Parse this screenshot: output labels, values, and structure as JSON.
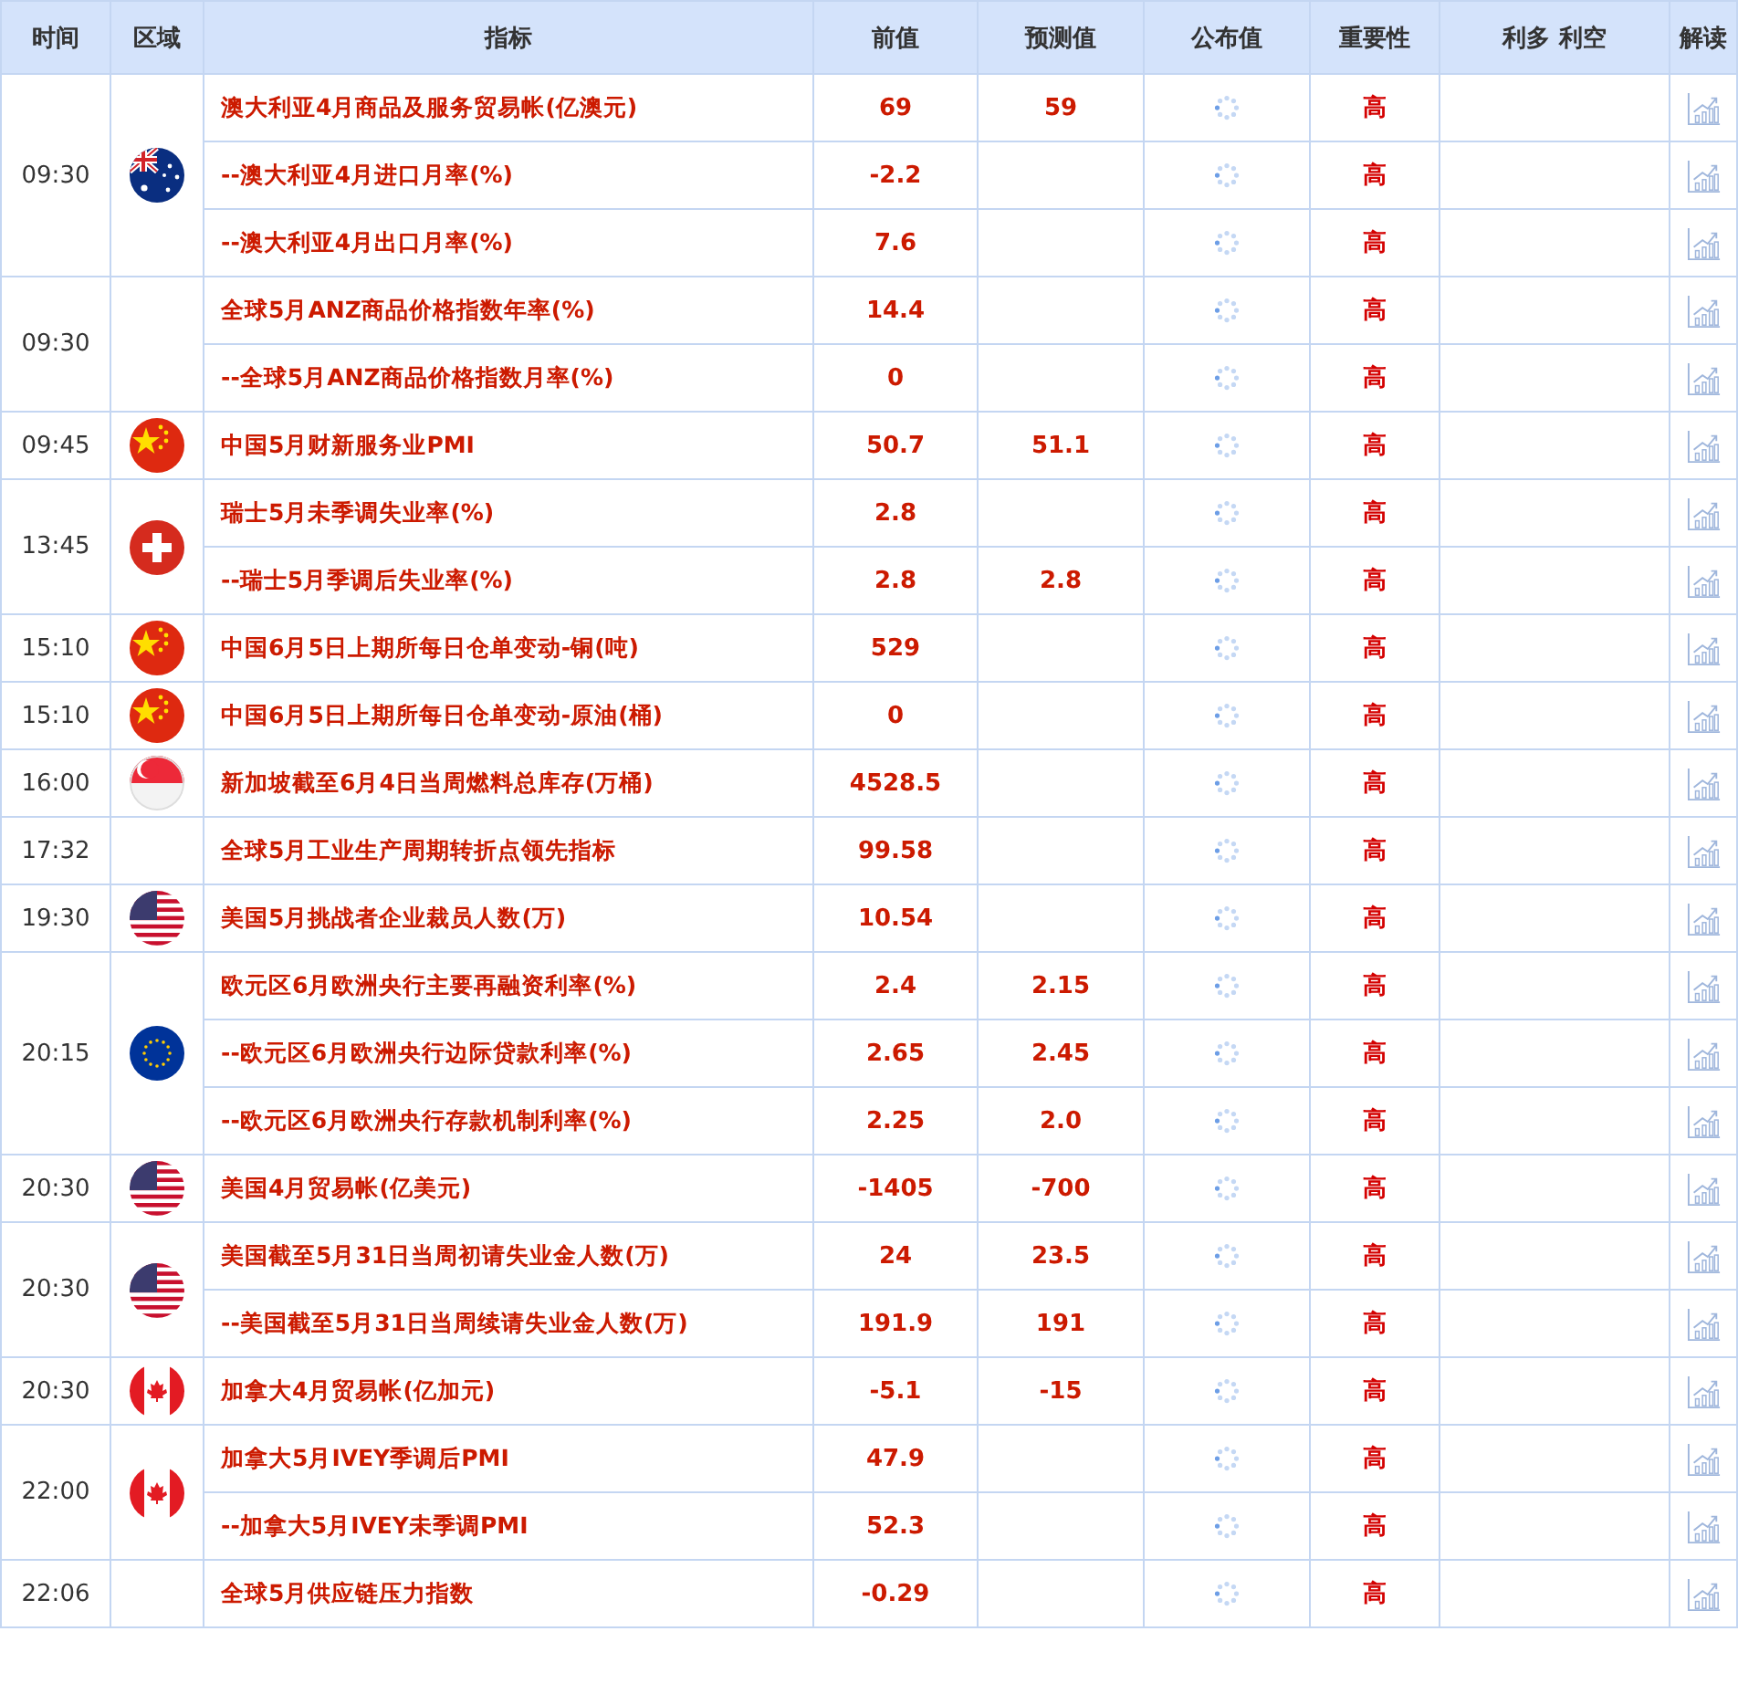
{
  "columns": [
    "时间",
    "区域",
    "指标",
    "前值",
    "预测值",
    "公布值",
    "重要性",
    "利多 利空",
    "解读"
  ],
  "groups": [
    {
      "time": "09:30",
      "kind": "au",
      "rows": [
        {
          "name": "澳大利亚4月商品及服务贸易帐(亿澳元)",
          "previous": "69",
          "forecast": "59",
          "importance": "高"
        },
        {
          "name": "--澳大利亚4月进口月率(%)",
          "previous": "-2.2",
          "importance": "高"
        },
        {
          "name": "--澳大利亚4月出口月率(%)",
          "previous": "7.6",
          "importance": "高"
        }
      ]
    },
    {
      "time": "09:30",
      "rows": [
        {
          "name": "全球5月ANZ商品价格指数年率(%)",
          "previous": "14.4",
          "importance": "高"
        },
        {
          "name": "--全球5月ANZ商品价格指数月率(%)",
          "previous": "0",
          "importance": "高"
        }
      ]
    },
    {
      "time": "09:45",
      "kind": "cn",
      "rows": [
        {
          "name": "中国5月财新服务业PMI",
          "previous": "50.7",
          "forecast": "51.1",
          "importance": "高"
        }
      ]
    },
    {
      "time": "13:45",
      "kind": "ch",
      "rows": [
        {
          "name": "瑞士5月未季调失业率(%)",
          "previous": "2.8",
          "importance": "高"
        },
        {
          "name": "--瑞士5月季调后失业率(%)",
          "previous": "2.8",
          "forecast": "2.8",
          "importance": "高"
        }
      ]
    },
    {
      "time": "15:10",
      "kind": "cn",
      "rows": [
        {
          "name": "中国6月5日上期所每日仓单变动-铜(吨)",
          "previous": "529",
          "importance": "高"
        }
      ]
    },
    {
      "time": "15:10",
      "kind": "cn",
      "rows": [
        {
          "name": "中国6月5日上期所每日仓单变动-原油(桶)",
          "previous": "0",
          "importance": "高"
        }
      ]
    },
    {
      "time": "16:00",
      "kind": "sg",
      "rows": [
        {
          "name": "新加坡截至6月4日当周燃料总库存(万桶)",
          "previous": "4528.5",
          "importance": "高"
        }
      ]
    },
    {
      "time": "17:32",
      "rows": [
        {
          "name": "全球5月工业生产周期转折点领先指标",
          "previous": "99.58",
          "importance": "高"
        }
      ]
    },
    {
      "time": "19:30",
      "kind": "us",
      "rows": [
        {
          "name": "美国5月挑战者企业裁员人数(万)",
          "previous": "10.54",
          "importance": "高"
        }
      ]
    },
    {
      "time": "20:15",
      "kind": "eu",
      "rows": [
        {
          "name": "欧元区6月欧洲央行主要再融资利率(%)",
          "previous": "2.4",
          "forecast": "2.15",
          "importance": "高"
        },
        {
          "name": "--欧元区6月欧洲央行边际贷款利率(%)",
          "previous": "2.65",
          "forecast": "2.45",
          "importance": "高"
        },
        {
          "name": "--欧元区6月欧洲央行存款机制利率(%)",
          "previous": "2.25",
          "forecast": "2.0",
          "importance": "高"
        }
      ]
    },
    {
      "time": "20:30",
      "kind": "us",
      "rows": [
        {
          "name": "美国4月贸易帐(亿美元)",
          "previous": "-1405",
          "forecast": "-700",
          "importance": "高"
        }
      ]
    },
    {
      "time": "20:30",
      "kind": "us",
      "rows": [
        {
          "name": "美国截至5月31日当周初请失业金人数(万)",
          "previous": "24",
          "forecast": "23.5",
          "importance": "高"
        },
        {
          "name": "--美国截至5月31日当周续请失业金人数(万)",
          "previous": "191.9",
          "forecast": "191",
          "importance": "高"
        }
      ]
    },
    {
      "time": "20:30",
      "kind": "ca",
      "rows": [
        {
          "name": "加拿大4月贸易帐(亿加元)",
          "previous": "-5.1",
          "forecast": "-15",
          "importance": "高"
        }
      ]
    },
    {
      "time": "22:00",
      "kind": "ca",
      "rows": [
        {
          "name": "加拿大5月IVEY季调后PMI",
          "previous": "47.9",
          "importance": "高"
        },
        {
          "name": "--加拿大5月IVEY未季调PMI",
          "previous": "52.3",
          "importance": "高"
        }
      ]
    },
    {
      "time": "22:06",
      "rows": [
        {
          "name": "全球5月供应链压力指数",
          "previous": "-0.29",
          "importance": "高"
        }
      ]
    }
  ]
}
